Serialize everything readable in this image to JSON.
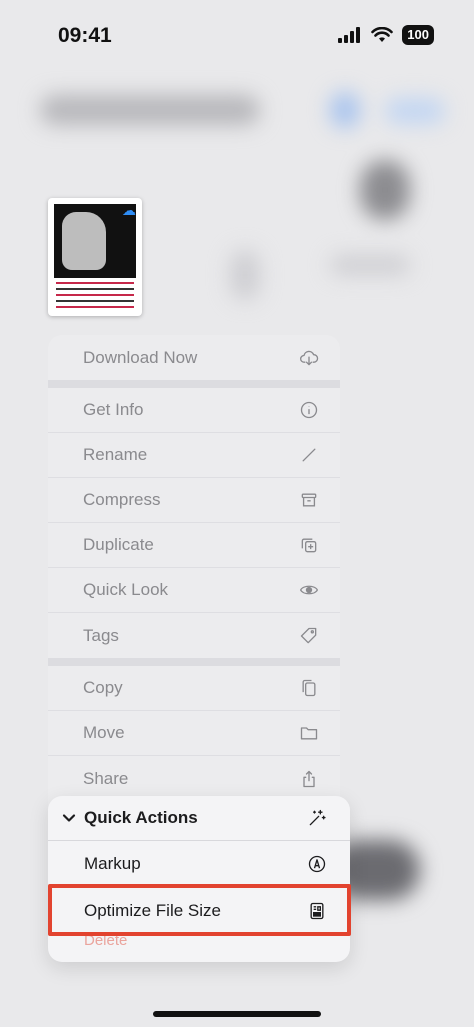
{
  "status_bar": {
    "time": "09:41",
    "battery": "100"
  },
  "menu": {
    "download": "Download Now",
    "group1": [
      "Get Info",
      "Rename",
      "Compress",
      "Duplicate",
      "Quick Look",
      "Tags"
    ],
    "group2": [
      "Copy",
      "Move",
      "Share"
    ],
    "delete": "Delete"
  },
  "quick_actions": {
    "header": "Quick Actions",
    "markup": "Markup",
    "optimize": "Optimize File Size"
  },
  "colors": {
    "highlight": "#e2432f",
    "accent": "#2f8df5"
  }
}
